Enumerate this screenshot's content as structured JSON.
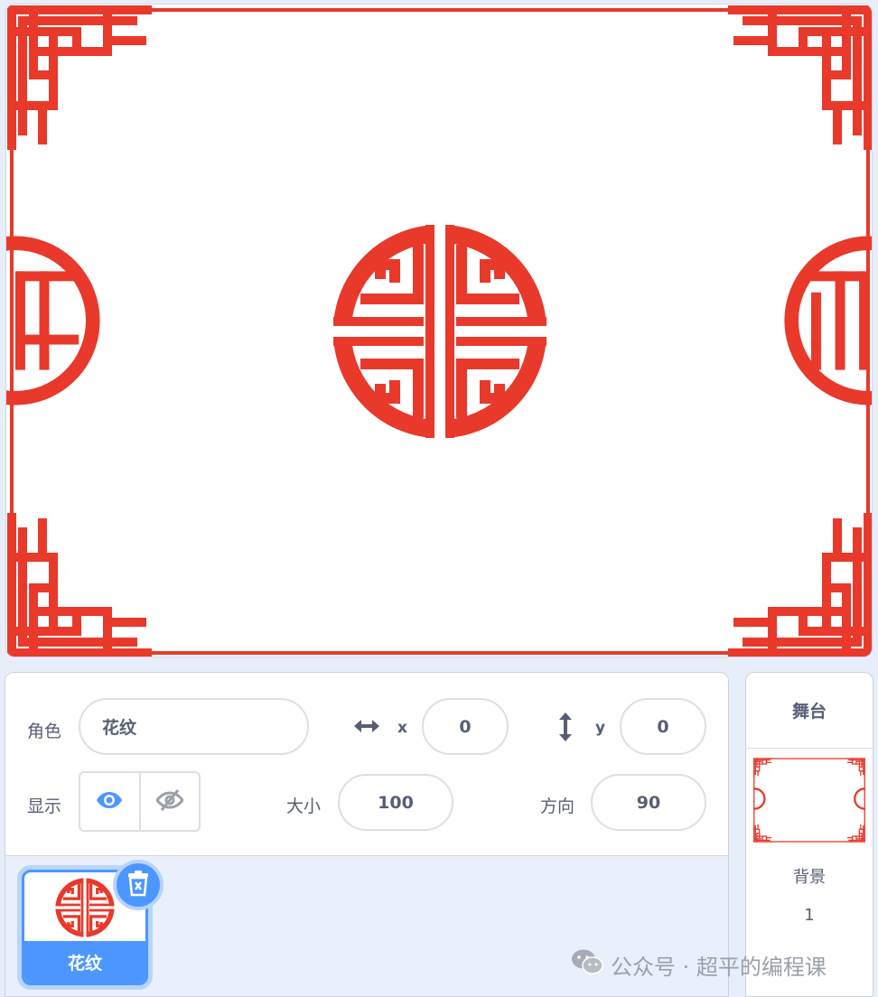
{
  "sprite": {
    "label": "角色",
    "name": "花纹",
    "x_axis": "x",
    "x_value": "0",
    "y_axis": "y",
    "y_value": "0",
    "show_label": "显示",
    "size_label": "大小",
    "size_value": "100",
    "direction_label": "方向",
    "direction_value": "90"
  },
  "sprite_list": [
    {
      "name": "花纹",
      "selected": true
    }
  ],
  "stage_panel": {
    "title": "舞台",
    "backdrop_label": "背景",
    "backdrop_count": "1"
  },
  "watermark": {
    "text": "公众号 · 超平的编程课",
    "icon": "wechat-icon"
  },
  "colors": {
    "pattern_red": "#e8392b",
    "accent_blue": "#4c97ff",
    "text": "#575e75",
    "panel_bg": "#e9f0fb"
  }
}
